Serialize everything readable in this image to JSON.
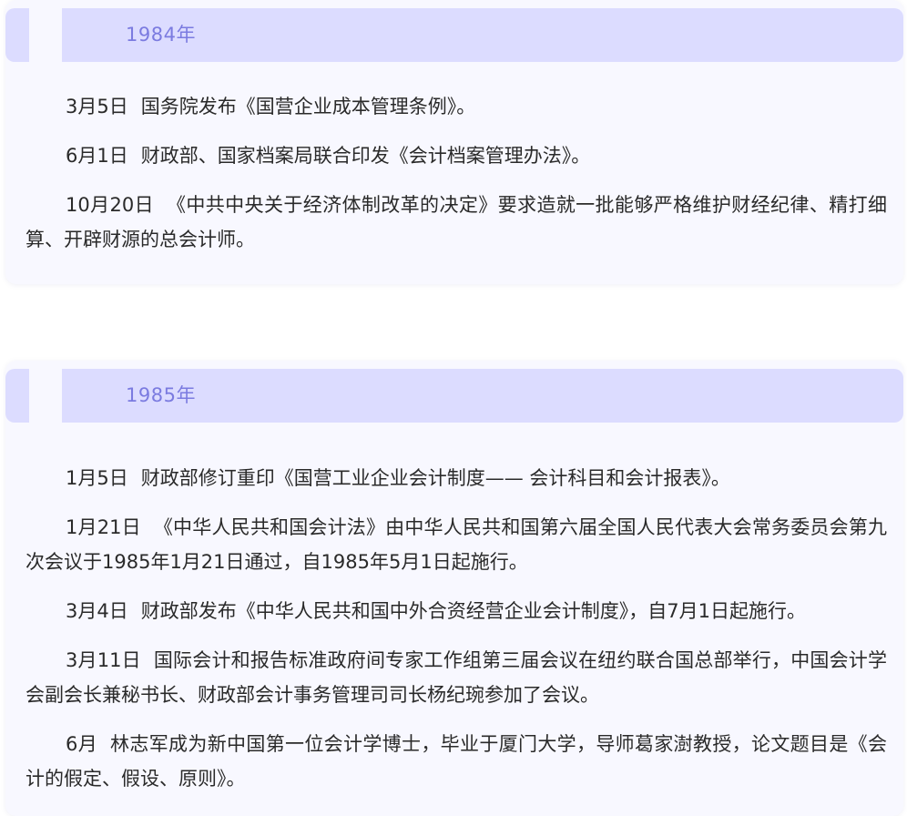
{
  "timeline": [
    {
      "year": "1984年",
      "events": [
        {
          "date": "3月5日",
          "text": "国务院发布《国营企业成本管理条例》。"
        },
        {
          "date": "6月1日",
          "text": "财政部、国家档案局联合印发《会计档案管理办法》。"
        },
        {
          "date": "10月20日",
          "text": "《中共中央关于经济体制改革的决定》要求造就一批能够严格维护财经纪律、精打细算、开辟财源的总会计师。"
        }
      ]
    },
    {
      "year": "1985年",
      "events": [
        {
          "date": "1月5日",
          "text": "财政部修订重印《国营工业企业会计制度—— 会计科目和会计报表》。"
        },
        {
          "date": "1月21日",
          "text": "《中华人民共和国会计法》由中华人民共和国第六届全国人民代表大会常务委员会第九次会议于1985年1月21日通过，自1985年5月1日起施行。"
        },
        {
          "date": "3月4日",
          "text": "财政部发布《中华人民共和国中外合资经营企业会计制度》，自7月1日起施行。"
        },
        {
          "date": "3月11日",
          "text": "国际会计和报告标准政府间专家工作组第三届会议在纽约联合国总部举行，中国会计学会副会长兼秘书长、财政部会计事务管理司司长杨纪琬参加了会议。"
        },
        {
          "date": "6月",
          "text": "林志军成为新中国第一位会计学博士，毕业于厦门大学，导师葛家澍教授，论文题目是《会计的假定、假设、原则》。"
        }
      ]
    }
  ],
  "colors": {
    "header_bg": "#dcdcff",
    "year_text": "#7b7be0",
    "card_bg": "#f8f8ff",
    "body_text": "#2a2a2a"
  }
}
